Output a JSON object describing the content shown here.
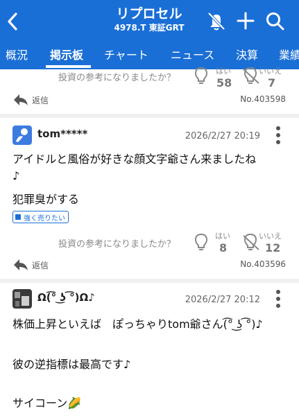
{
  "header": {
    "title": "リプロセル",
    "subtitle": "4978.T 東証GRT"
  },
  "tabs": [
    {
      "label": "概況"
    },
    {
      "label": "掲示板"
    },
    {
      "label": "チャート"
    },
    {
      "label": "ニュース"
    },
    {
      "label": "決算"
    },
    {
      "label": "業績"
    }
  ],
  "vote_prompt": "投資の参考になりましたか？",
  "yes_label": "はい",
  "no_label": "いいえ",
  "reply_label": "返信",
  "posts": [
    {
      "yes_count": "58",
      "no_count": "7",
      "post_no": "No.403598"
    },
    {
      "username": "tom*****",
      "date": "2026/2/27 20:19",
      "lines": [
        "アイドルと風俗が好きな顔文字爺さん来ましたね",
        "♪",
        "犯罪臭がする"
      ],
      "badge": "強く売りたい",
      "yes_count": "8",
      "no_count": "12",
      "post_no": "No.403596"
    },
    {
      "username": "Ω(͡° ͜ʖ ͡°)Ω♪",
      "date": "2026/2/27 20:12",
      "lines": [
        "株価上昇といえば　ぽっちゃりtom爺さん(͡° ͜ʖ ͡°)♪",
        "",
        "彼の逆指標は最高です♪",
        "",
        "サイコーン🌽"
      ]
    }
  ],
  "colors": {
    "brand": "#1a6fd6",
    "muted": "#888888"
  },
  "icons": [
    "back-icon",
    "bell-off-icon",
    "plus-icon",
    "search-icon",
    "lightbulb-icon",
    "lightbulb-off-icon",
    "reply-icon",
    "kebab-icon",
    "avatar-icon"
  ]
}
